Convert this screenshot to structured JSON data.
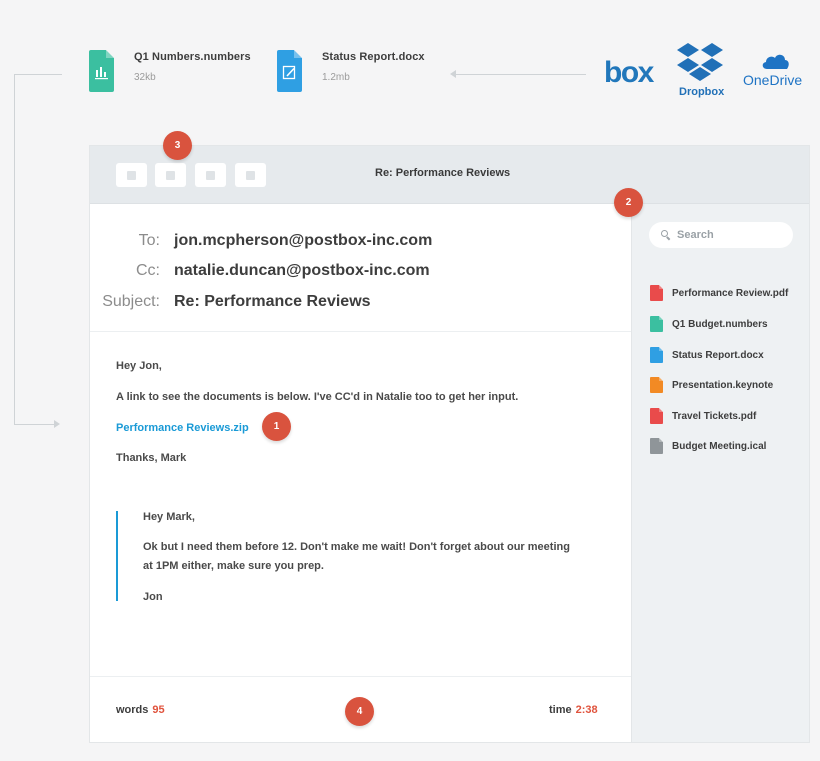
{
  "attachments": [
    {
      "name": "Q1 Numbers.numbers",
      "size": "32kb",
      "color": "#3bbfa0",
      "icon": "bar-chart-icon"
    },
    {
      "name": "Status Report.docx",
      "size": "1.2mb",
      "color": "#2f9fe3",
      "icon": "edit-doc-icon"
    }
  ],
  "cloud_services": {
    "box": "box",
    "dropbox": "Dropbox",
    "onedrive": "OneDrive",
    "colors": {
      "box": "#2177bb",
      "dropbox": "#2170b7",
      "onedrive": "#1e73c4"
    }
  },
  "window": {
    "title": "Re: Performance Reviews",
    "toolbar_buttons": 4
  },
  "header": {
    "to_label": "To:",
    "to_value": "jon.mcpherson@postbox-inc.com",
    "cc_label": "Cc:",
    "cc_value": "natalie.duncan@postbox-inc.com",
    "subject_label": "Subject:",
    "subject_value": "Re: Performance Reviews"
  },
  "body": {
    "greeting": "Hey Jon,",
    "line1": "A link to see the documents is below. I've CC'd in Natalie too to get her input.",
    "link": "Performance Reviews.zip",
    "signoff": "Thanks, Mark"
  },
  "quote": {
    "greeting": "Hey Mark,",
    "line1": "Ok but I need them before 12. Don't make me wait! Don't forget about our meeting",
    "line2": "at 1PM either, make sure you prep.",
    "signoff": "Jon"
  },
  "footer": {
    "words_label": "words",
    "words_value": "95",
    "time_label": "time",
    "time_value": "2:38"
  },
  "sidebar": {
    "search_placeholder": "Search",
    "files": [
      {
        "name": "Performance Review.pdf",
        "color": "#e94b4b"
      },
      {
        "name": "Q1 Budget.numbers",
        "color": "#3bbfa0"
      },
      {
        "name": "Status Report.docx",
        "color": "#2f9fe3"
      },
      {
        "name": "Presentation.keynote",
        "color": "#f28a24"
      },
      {
        "name": "Travel Tickets.pdf",
        "color": "#e94b4b"
      },
      {
        "name": "Budget Meeting.ical",
        "color": "#8f9599"
      }
    ]
  },
  "callouts": [
    "1",
    "2",
    "3",
    "4"
  ],
  "accent_color": "#1a9ad6",
  "badge_color": "#d9533e"
}
